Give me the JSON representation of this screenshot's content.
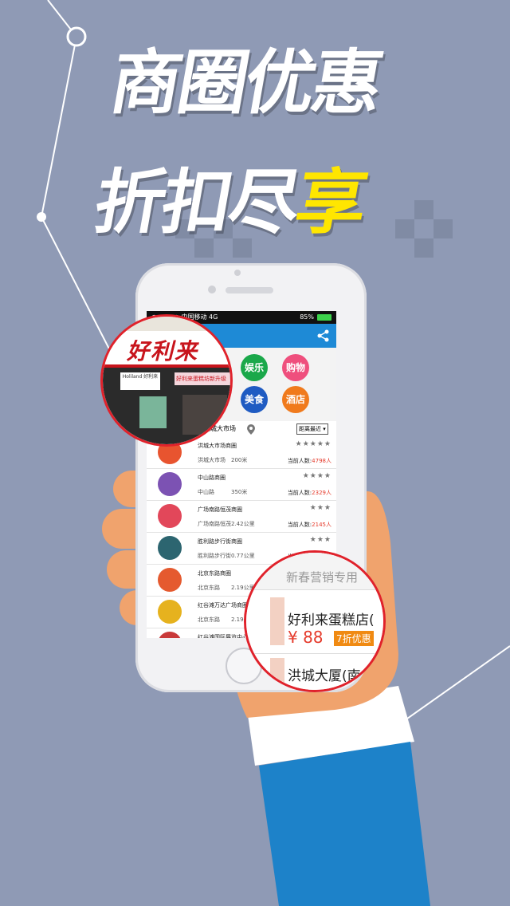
{
  "headline": {
    "line1": "商圈优惠",
    "line2_prefix": "折扣尽",
    "line2_accent": "享"
  },
  "colors": {
    "background": "#8f9ab5",
    "accent_yellow": "#ffe600",
    "app_blue": "#1e8ad6",
    "lens_red": "#e0222b",
    "price_red": "#e53a2b"
  },
  "status_bar": {
    "carrier": "●●●●● 中国移动 4G",
    "battery": "85%"
  },
  "app_bar": {
    "share_icon": "share-icon"
  },
  "categories": [
    {
      "label": "娱乐",
      "color": "#1aa84a"
    },
    {
      "label": "购物",
      "color": "#ef4f7d"
    },
    {
      "label": "美食",
      "color": "#1f5bc2"
    },
    {
      "label": "酒店",
      "color": "#f07a1c"
    }
  ],
  "location_bar": {
    "place": "洪城大市场",
    "sort": "距离最近"
  },
  "list": [
    {
      "name": "洪城大市场商圈",
      "addr": "洪城大市场",
      "dist": "200米",
      "stars": "★★★★★",
      "count_label": "当前人数:",
      "count": "4798人",
      "icon_color": "#e8542f"
    },
    {
      "name": "中山路商圈",
      "addr": "中山路",
      "dist": "350米",
      "stars": "★★★★",
      "count_label": "当前人数:",
      "count": "2329人",
      "icon_color": "#7c52b3"
    },
    {
      "name": "广场南路恒茂商圈",
      "addr": "广场南路恒茂",
      "dist": "2.42公里",
      "stars": "★★★",
      "count_label": "当前人数:",
      "count": "2145人",
      "icon_color": "#e2475a"
    },
    {
      "name": "胜利路步行街商圈",
      "addr": "胜利路步行街",
      "dist": "0.77公里",
      "stars": "★★★",
      "count_label": "当前人数:",
      "count": "1819人",
      "icon_color": "#2c6570"
    },
    {
      "name": "北京东路商圈",
      "addr": "北京东路",
      "dist": "2.19公里",
      "stars": "",
      "count_label": "",
      "count": "",
      "icon_color": "#e55a2f"
    },
    {
      "name": "红谷滩万达广场商圈",
      "addr": "北京东路",
      "dist": "2.19公里",
      "stars": "",
      "count_label": "",
      "count": "",
      "icon_color": "#e6b21e"
    },
    {
      "name": "红谷滩国际展览中心",
      "addr": "",
      "dist": "",
      "stars": "",
      "count_label": "",
      "count": "",
      "icon_color": "#c93a3a"
    }
  ],
  "lens_left": {
    "store_sign": "好利来",
    "small_sign": "好利来蛋糕坊新升级",
    "brand": "Holiland 好利来"
  },
  "lens_right": {
    "header": "新春营销专用",
    "shop_name": "好利来蛋糕店(",
    "price": "¥ 88",
    "discount": "7折优惠",
    "shop2_name": "洪城大厦(南"
  }
}
